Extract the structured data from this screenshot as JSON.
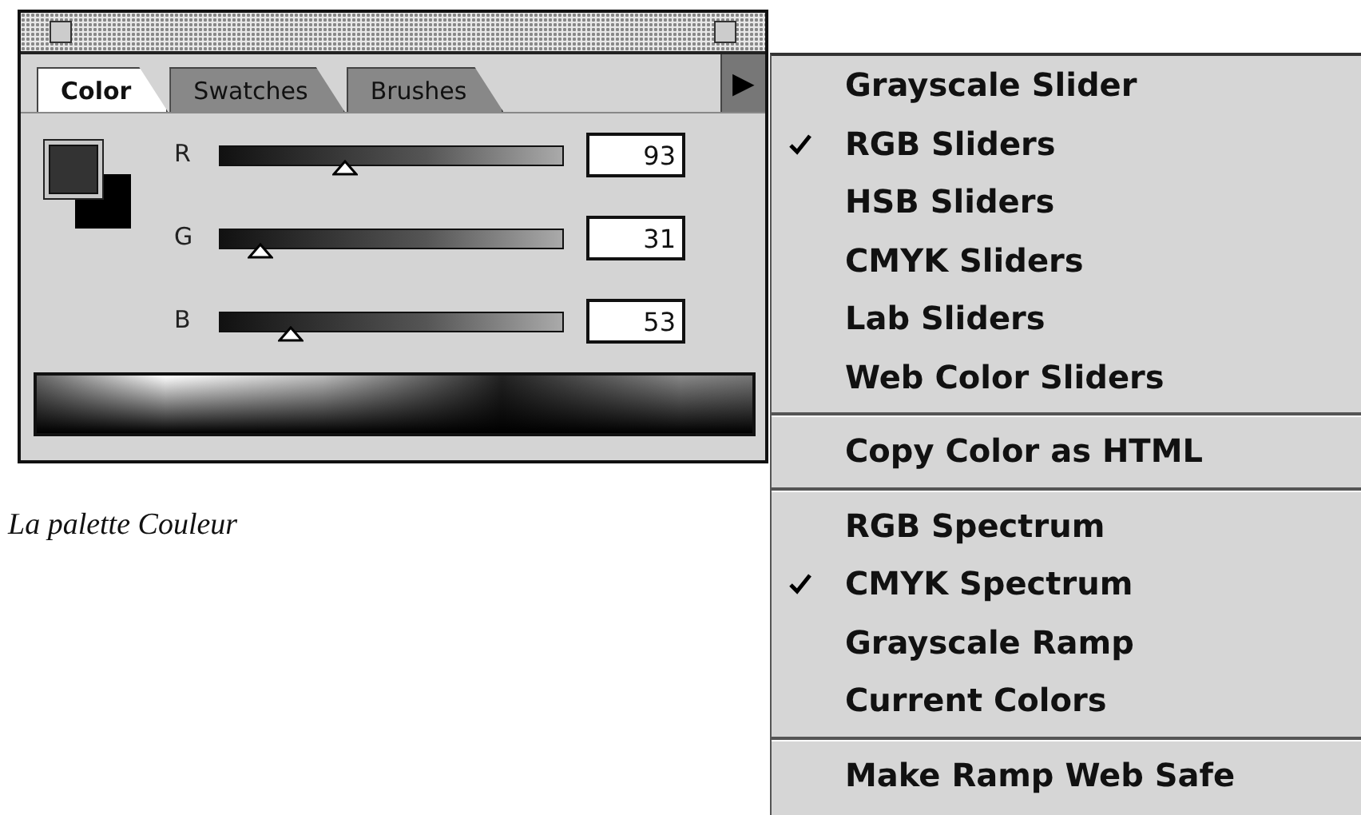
{
  "palette": {
    "tabs": [
      {
        "label": "Color",
        "selected": true
      },
      {
        "label": "Swatches",
        "selected": false
      },
      {
        "label": "Brushes",
        "selected": false
      }
    ],
    "menu_button": "▶",
    "channels": [
      {
        "name": "R",
        "level": 0.365,
        "value": "93"
      },
      {
        "name": "G",
        "level": 0.122,
        "value": "31"
      },
      {
        "name": "B",
        "level": 0.208,
        "value": "53"
      }
    ]
  },
  "caption": "La palette Couleur",
  "menu": {
    "groups": [
      [
        {
          "label": "Grayscale Slider",
          "checked": false
        },
        {
          "label": "RGB Sliders",
          "checked": true
        },
        {
          "label": "HSB Sliders",
          "checked": false
        },
        {
          "label": "CMYK Sliders",
          "checked": false
        },
        {
          "label": "Lab Sliders",
          "checked": false
        },
        {
          "label": "Web Color Sliders",
          "checked": false
        }
      ],
      [
        {
          "label": "Copy Color as HTML",
          "checked": false
        }
      ],
      [
        {
          "label": "RGB Spectrum",
          "checked": false
        },
        {
          "label": "CMYK Spectrum",
          "checked": true
        },
        {
          "label": "Grayscale Ramp",
          "checked": false
        },
        {
          "label": "Current Colors",
          "checked": false
        }
      ],
      [
        {
          "label": "Make Ramp Web Safe",
          "checked": false
        }
      ]
    ]
  }
}
